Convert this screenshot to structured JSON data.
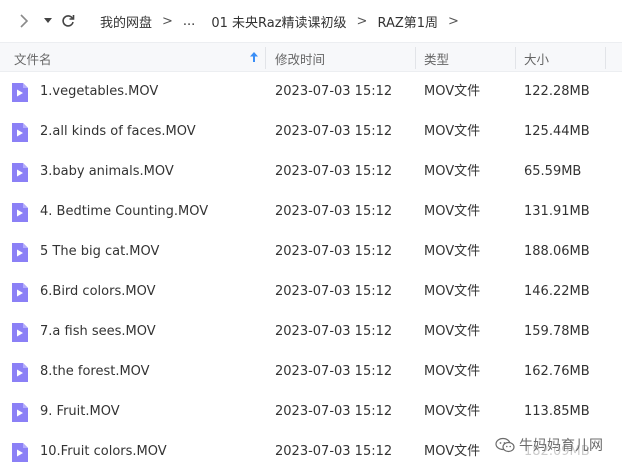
{
  "nav": {
    "breadcrumbs": [
      "我的网盘",
      "...",
      "01 未央Raz精读课初级",
      "RAZ第1周"
    ],
    "separator": ">"
  },
  "columns": {
    "name": "文件名",
    "modified": "修改时间",
    "type": "类型",
    "size": "大小"
  },
  "files": [
    {
      "name": "1.vegetables.MOV",
      "modified": "2023-07-03 15:12",
      "type": "MOV文件",
      "size": "122.28MB"
    },
    {
      "name": "2.all kinds of faces.MOV",
      "modified": "2023-07-03 15:12",
      "type": "MOV文件",
      "size": "125.44MB"
    },
    {
      "name": "3.baby animals.MOV",
      "modified": "2023-07-03 15:12",
      "type": "MOV文件",
      "size": "65.59MB"
    },
    {
      "name": "4. Bedtime Counting.MOV",
      "modified": "2023-07-03 15:12",
      "type": "MOV文件",
      "size": "131.91MB"
    },
    {
      "name": "5 The big cat.MOV",
      "modified": "2023-07-03 15:12",
      "type": "MOV文件",
      "size": "188.06MB"
    },
    {
      "name": "6.Bird colors.MOV",
      "modified": "2023-07-03 15:12",
      "type": "MOV文件",
      "size": "146.22MB"
    },
    {
      "name": "7.a fish sees.MOV",
      "modified": "2023-07-03 15:12",
      "type": "MOV文件",
      "size": "159.78MB"
    },
    {
      "name": "8.the forest.MOV",
      "modified": "2023-07-03 15:12",
      "type": "MOV文件",
      "size": "162.76MB"
    },
    {
      "name": "9. Fruit.MOV",
      "modified": "2023-07-03 15:12",
      "type": "MOV文件",
      "size": "113.85MB"
    },
    {
      "name": "10.Fruit colors.MOV",
      "modified": "2023-07-03 15:12",
      "type": "MOV文件",
      "size": "182.09MB"
    }
  ],
  "watermark": {
    "text": "牛妈妈育儿网",
    "icon": "wechat-icon"
  },
  "colors": {
    "file_icon": "#8b80f6",
    "sort_arrow": "#3a8ef6",
    "header_bg": "#f7f8fa"
  }
}
